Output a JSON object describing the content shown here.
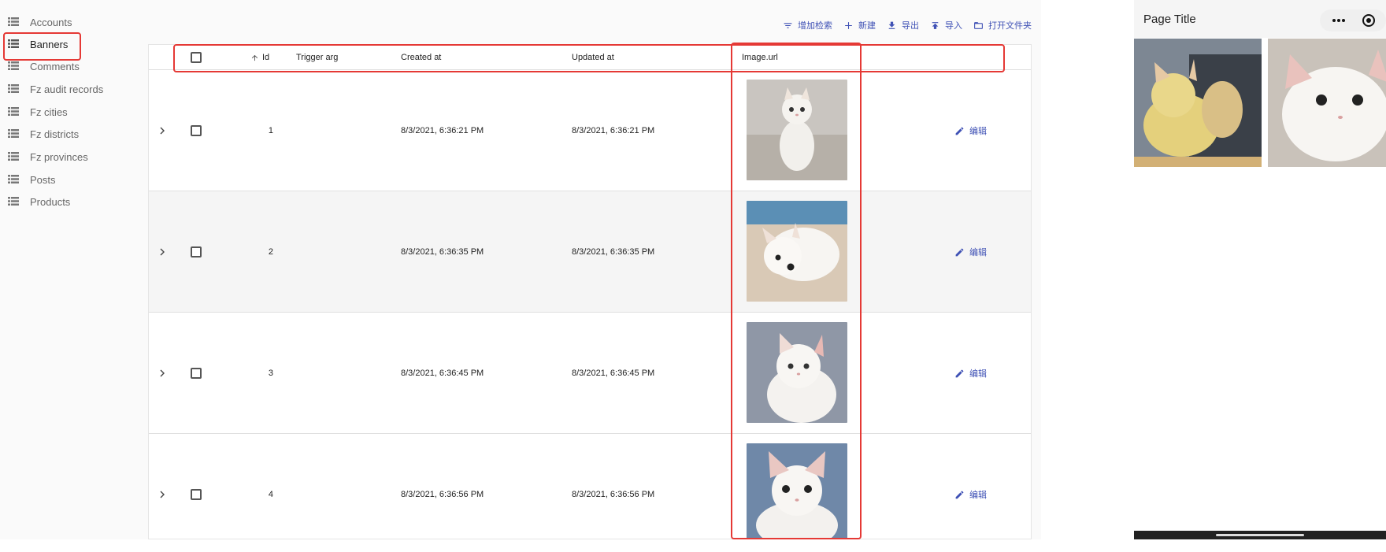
{
  "sidebar": {
    "items": [
      {
        "label": "Accounts"
      },
      {
        "label": "Banners"
      },
      {
        "label": "Comments"
      },
      {
        "label": "Fz audit records"
      },
      {
        "label": "Fz cities"
      },
      {
        "label": "Fz districts"
      },
      {
        "label": "Fz provinces"
      },
      {
        "label": "Posts"
      },
      {
        "label": "Products"
      }
    ]
  },
  "toolbar": {
    "filter_label": "增加检索",
    "create_label": "新建",
    "export_label": "导出",
    "import_label": "导入",
    "open_folder_label": "打开文件夹"
  },
  "table": {
    "columns": {
      "id": "Id",
      "trigger_arg": "Trigger arg",
      "created_at": "Created at",
      "updated_at": "Updated at",
      "image_url": "Image.url"
    },
    "rows": [
      {
        "id": "1",
        "trigger_arg": "",
        "created_at": "8/3/2021, 6:36:21 PM",
        "updated_at": "8/3/2021, 6:36:21 PM",
        "edit_label": "编辑"
      },
      {
        "id": "2",
        "trigger_arg": "",
        "created_at": "8/3/2021, 6:36:35 PM",
        "updated_at": "8/3/2021, 6:36:35 PM",
        "edit_label": "编辑"
      },
      {
        "id": "3",
        "trigger_arg": "",
        "created_at": "8/3/2021, 6:36:45 PM",
        "updated_at": "8/3/2021, 6:36:45 PM",
        "edit_label": "编辑"
      },
      {
        "id": "4",
        "trigger_arg": "",
        "created_at": "8/3/2021, 6:36:56 PM",
        "updated_at": "8/3/2021, 6:36:56 PM",
        "edit_label": "编辑"
      }
    ]
  },
  "phone": {
    "title": "Page Title"
  },
  "colors": {
    "accent": "#3f51b5",
    "highlight": "#e53935"
  }
}
